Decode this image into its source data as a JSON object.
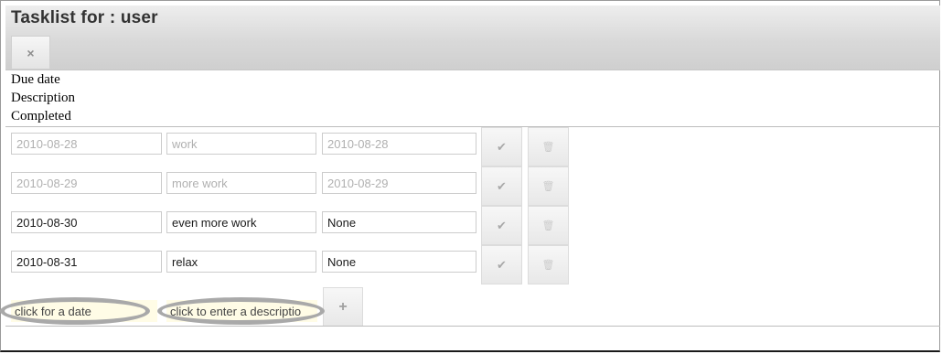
{
  "header": {
    "title": "Tasklist for : user",
    "close_icon": "×"
  },
  "columns": [
    "Due date",
    "Description",
    "Completed"
  ],
  "tasks": [
    {
      "due": "2010-08-28",
      "description": "work",
      "completed": "2010-08-28",
      "done": true
    },
    {
      "due": "2010-08-29",
      "description": "more work",
      "completed": "2010-08-29",
      "done": true
    },
    {
      "due": "2010-08-30",
      "description": "even more work",
      "completed": "None",
      "done": false
    },
    {
      "due": "2010-08-31",
      "description": "relax",
      "completed": "None",
      "done": false
    }
  ],
  "new_task": {
    "date_placeholder": "click for a date",
    "description_placeholder": "click to enter a descriptio"
  },
  "icons": {
    "check": "✔",
    "trash": "🗑",
    "plus": "+"
  },
  "colors": {
    "muted_text": "#b0b0b0",
    "input_highlight": "#fffce6",
    "annotation": "#a9a9a9"
  }
}
